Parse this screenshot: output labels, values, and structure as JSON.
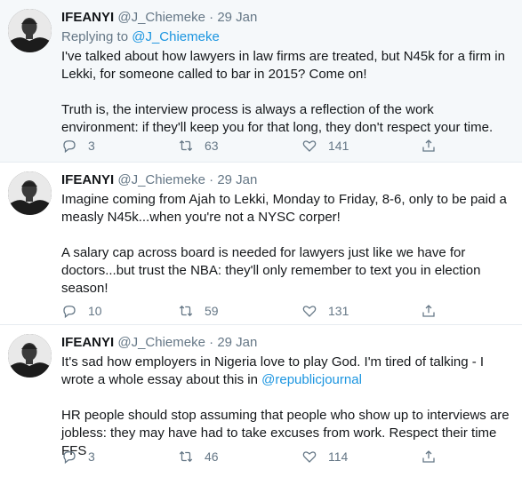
{
  "tweets": [
    {
      "name": "IFEANYI",
      "handle": "@J_Chiemeke",
      "dot": "·",
      "date": "29 Jan",
      "reply_prefix": "Replying to ",
      "reply_handle": "@J_Chiemeke",
      "paragraphs": [
        "I've talked about how lawyers in law firms are treated, but N45k for a firm in Lekki, for someone called to bar in 2015? Come on!",
        "Truth is, the interview process is always a reflection of the work environment: if they'll keep you for that long, they don't respect your time."
      ],
      "replies": "3",
      "retweets": "63",
      "likes": "141"
    },
    {
      "name": "IFEANYI",
      "handle": "@J_Chiemeke",
      "dot": "·",
      "date": "29 Jan",
      "paragraphs": [
        "Imagine coming from Ajah to Lekki, Monday to Friday, 8-6, only to be paid a measly N45k...when you're not a NYSC corper!",
        "A salary cap across board is needed for lawyers just like we have for doctors...but trust the NBA: they'll only remember to text you in election season!"
      ],
      "replies": "10",
      "retweets": "59",
      "likes": "131"
    },
    {
      "name": "IFEANYI",
      "handle": "@J_Chiemeke",
      "dot": "·",
      "date": "29 Jan",
      "p1_before": "It's sad how employers in Nigeria love to play God. I'm tired of talking - I wrote a whole essay about this in ",
      "p1_link": "@republicjournal",
      "p2": "HR people should stop assuming that people who show up to interviews are jobless: they may have had to take excuses from work. Respect their time FFS",
      "replies": "3",
      "retweets": "46",
      "likes": "114"
    }
  ],
  "icons": {
    "reply": "reply-icon",
    "retweet": "retweet-icon",
    "like": "heart-icon",
    "share": "share-icon"
  },
  "colors": {
    "link": "#1b95e0",
    "muted": "#657786",
    "highlight_bg": "#f5f8fa"
  }
}
